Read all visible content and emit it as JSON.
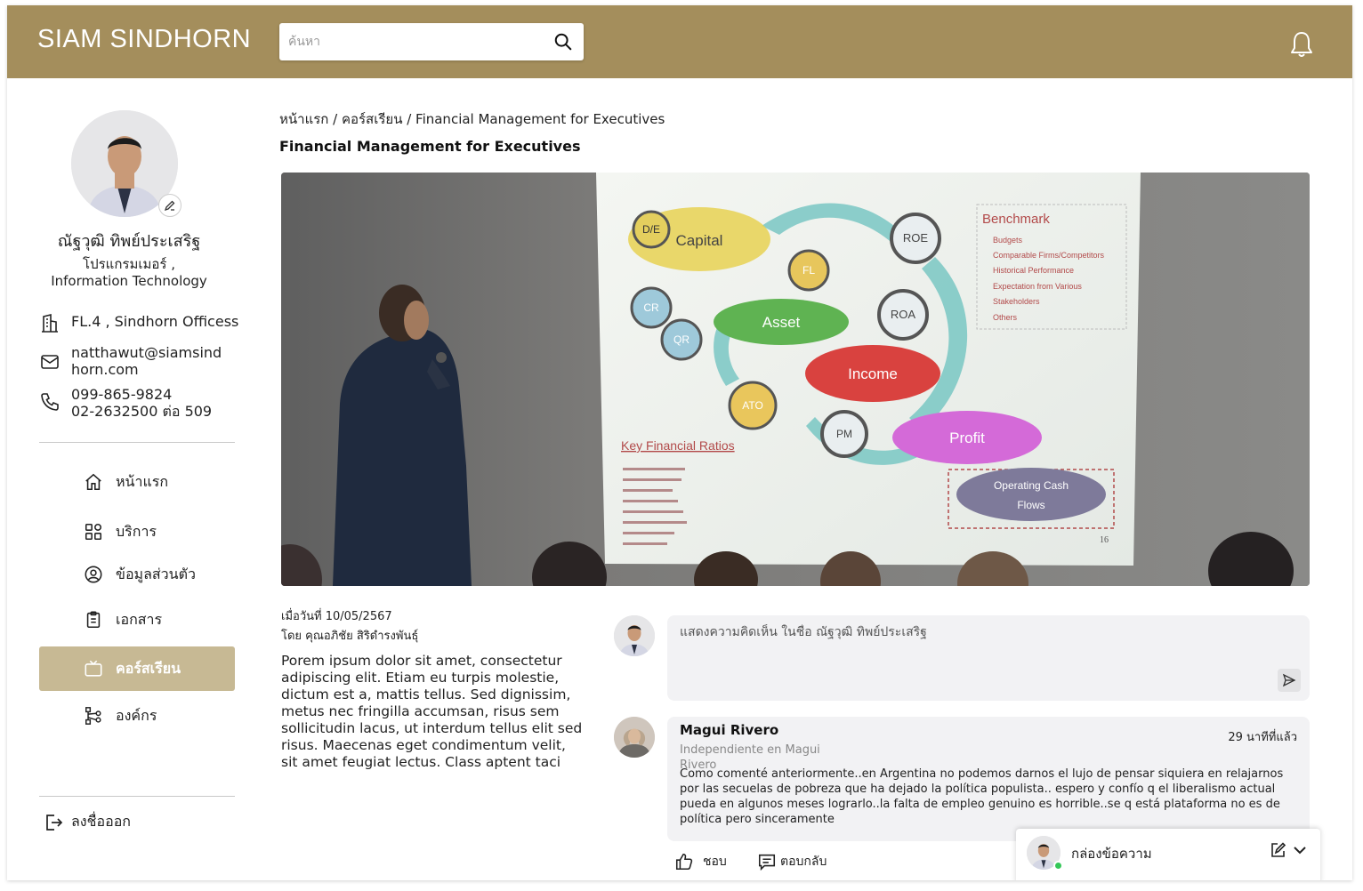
{
  "header": {
    "brand": "SIAM SINDHORN",
    "search_placeholder": "ค้นหา"
  },
  "profile": {
    "name": "ณัฐวุฒิ ทิพย์ประเสริฐ",
    "role_line1": "โปรแกรมเมอร์ ,",
    "role_line2": "Information Technology",
    "location": "FL.4 , Sindhorn Officess",
    "email_line1": "natthawut@siamsind",
    "email_line2": "horn.com",
    "phone_line1": "099-865-9824",
    "phone_line2": "02-2632500 ต่อ 509"
  },
  "nav": {
    "items": [
      {
        "label": "หน้าแรก",
        "icon": "home-icon"
      },
      {
        "label": "บริการ",
        "icon": "grid-icon"
      },
      {
        "label": "ข้อมูลส่วนตัว",
        "icon": "user-circle-icon"
      },
      {
        "label": "เอกสาร",
        "icon": "clipboard-icon"
      },
      {
        "label": "คอร์สเรียน",
        "icon": "tv-icon",
        "active": true
      },
      {
        "label": "องค์กร",
        "icon": "org-tree-icon"
      }
    ],
    "logout": "ลงชื่อออก"
  },
  "main": {
    "breadcrumb": "หน้าแรก / คอร์สเรียน / Financial Management for Executives",
    "title": "Financial Management for Executives",
    "date": "เมื่อวันที่ 10/05/2567",
    "author": "โดย คุณอภิชัย สิริดำรงพันธุ์",
    "body": "Porem ipsum dolor sit amet, consectetur adipiscing elit. Etiam eu turpis molestie, dictum est a, mattis tellus. Sed dignissim, metus nec fringilla accumsan, risus sem sollicitudin lacus, ut interdum tellus elit sed risus. Maecenas eget condimentum velit, sit amet feugiat lectus. Class aptent taci"
  },
  "slide": {
    "benchmark_title": "Benchmark",
    "benchmark_items": [
      "Budgets",
      "Comparable Firms/Competitors",
      "Historical Performance",
      "Expectation from Various",
      "Stakeholders",
      "Others"
    ],
    "nodes": [
      "D/E",
      "Capital",
      "FL",
      "ROE",
      "CR",
      "QR",
      "Asset",
      "ROA",
      "Income",
      "ATO",
      "PM",
      "Profit"
    ],
    "ratios_title": "Key Financial Ratios",
    "cash_flows_line1": "Operating Cash",
    "cash_flows_line2": "Flows",
    "page_number": "16"
  },
  "comments": {
    "input_placeholder": "แสดงความคิดเห็น ในชื่อ ณัฐวุฒิ ทิพย์ประเสริฐ",
    "items": [
      {
        "name": "Magui Rivero",
        "subtitle": "Independiente en Magui Rivero",
        "time": "29 นาทีที่แล้ว",
        "text": "Como comenté anteriormente..en Argentina no podemos darnos el lujo de pensar siquiera en relajarnos por las secuelas de pobreza que ha dejado la política populista.. espero y confío q el liberalismo actual pueda en algunos meses lograrlo..la falta de empleo genuino es horrible..se q está plataforma no es de política pero sinceramente"
      }
    ],
    "like_label": "ชอบ",
    "reply_label": "ตอบกลับ"
  },
  "chat_dock": {
    "label": "กล่องข้อความ"
  },
  "colors": {
    "header": "#a48e5c",
    "nav_active": "#c7b994",
    "online": "#35c759"
  }
}
